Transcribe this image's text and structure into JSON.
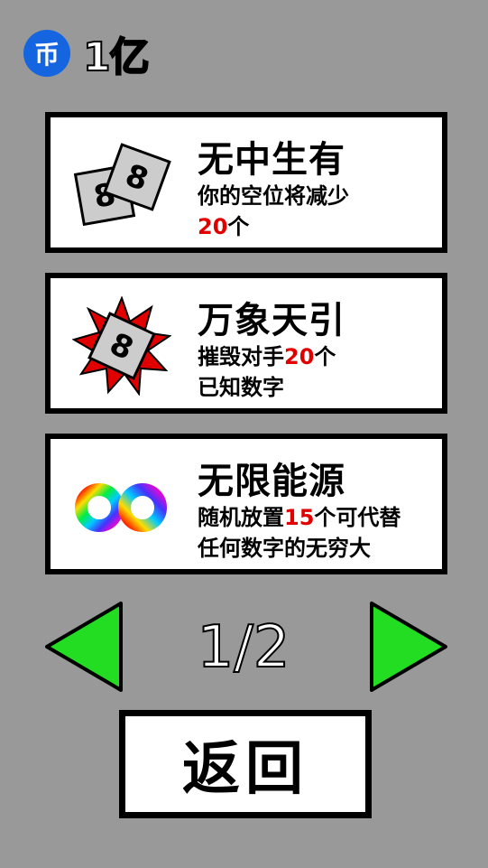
{
  "header": {
    "coin_icon_glyph": "币",
    "coin_amount": "1亿"
  },
  "cards": [
    {
      "title": "无中生有",
      "desc_line1": "你的空位将减少",
      "desc_line2_num": "20",
      "desc_line2_suffix": "个",
      "icon": "two-dice-8-icon",
      "tile_digit": "8"
    },
    {
      "title": "万象天引",
      "desc_line1_prefix": "摧毁对手",
      "desc_line1_num": "20",
      "desc_line1_suffix": "个",
      "desc_line2": "已知数字",
      "icon": "spiked-tile-8-icon",
      "tile_digit": "8"
    },
    {
      "title": "无限能源",
      "desc_line1_prefix": "随机放置",
      "desc_line1_num": "15",
      "desc_line1_suffix": "个可代替",
      "desc_line2": "任何数字的无穷大",
      "icon": "rainbow-infinity-icon"
    }
  ],
  "pager": {
    "indicator": "1/2",
    "prev_icon": "left-arrow-icon",
    "next_icon": "right-arrow-icon"
  },
  "back_button": {
    "label": "返回"
  },
  "colors": {
    "background": "#999999",
    "coin": "#1565e0",
    "highlight_number": "#e00000",
    "arrow": "#22dd22"
  }
}
